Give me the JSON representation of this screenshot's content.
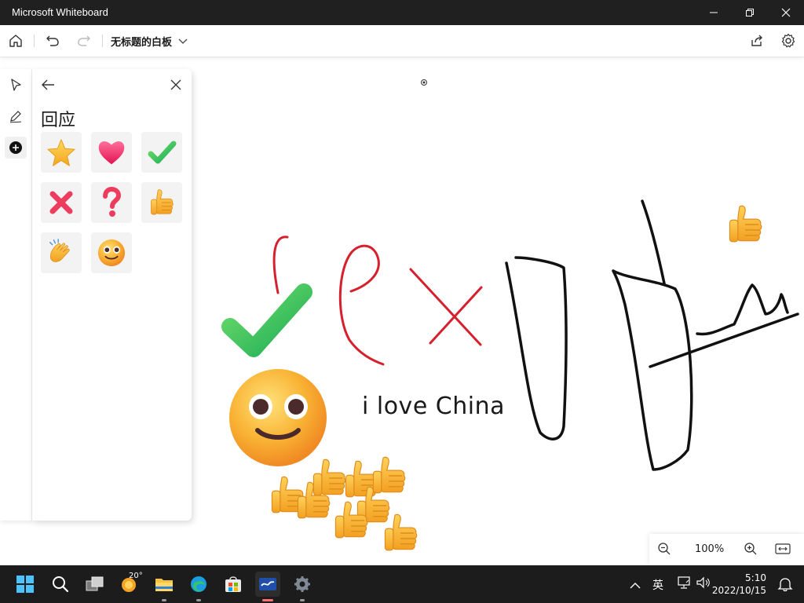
{
  "window": {
    "title": "Microsoft Whiteboard"
  },
  "toolbar": {
    "board_title": "无标题的白板"
  },
  "panel": {
    "title": "回应",
    "reactions": [
      "star-icon",
      "heart-icon",
      "check-icon",
      "cross-icon",
      "question-icon",
      "thumbs-up-icon",
      "clapping-hands-icon",
      "smiling-face-icon"
    ]
  },
  "canvas": {
    "text": "i love China"
  },
  "zoom": {
    "level": "100%"
  },
  "taskbar": {
    "weather_temp": "20°",
    "ime_label": "英",
    "time": "5:10",
    "date": "2022/10/15"
  },
  "colors": {
    "titlebar": "#202020",
    "taskbar": "#1c1c1c",
    "ink_red": "#d6202e",
    "ink_black": "#111111",
    "check_green": "#3bb54a",
    "emoji_yellow": "#f6b832"
  }
}
